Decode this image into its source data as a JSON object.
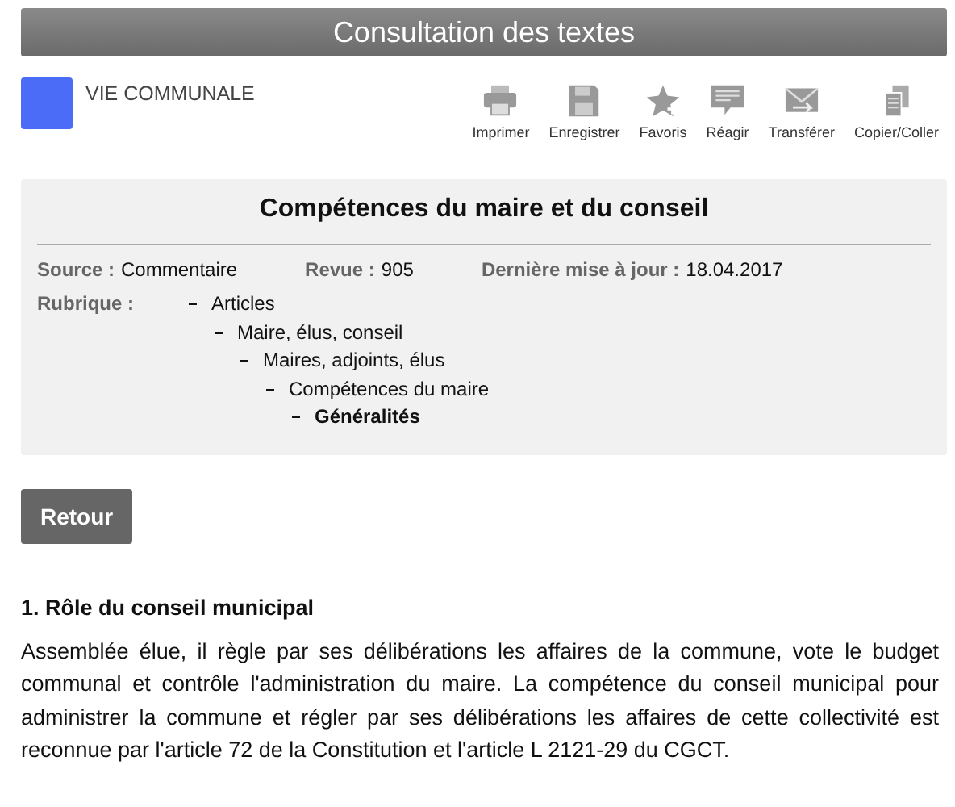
{
  "header": {
    "title": "Consultation des textes"
  },
  "category": {
    "color": "#4a6cf7",
    "label": "VIE COMMUNALE"
  },
  "toolbar": [
    {
      "kind": "print",
      "label": "Imprimer"
    },
    {
      "kind": "save",
      "label": "Enregistrer"
    },
    {
      "kind": "favorite",
      "label": "Favoris"
    },
    {
      "kind": "comment",
      "label": "Réagir"
    },
    {
      "kind": "mail",
      "label": "Transférer"
    },
    {
      "kind": "copy",
      "label": "Copier/Coller"
    }
  ],
  "document": {
    "title": "Compétences du maire et du conseil",
    "meta": [
      {
        "label": "Source :",
        "value": "Commentaire"
      },
      {
        "label": "Revue :",
        "value": "905"
      },
      {
        "label": "Dernière mise à jour :",
        "value": "18.04.2017"
      }
    ],
    "rubrique_label": "Rubrique :",
    "rubrique": [
      {
        "label": "Articles",
        "current": false,
        "children": [
          {
            "label": "Maire, élus, conseil",
            "current": false,
            "children": [
              {
                "label": "Maires, adjoints, élus",
                "current": false,
                "children": [
                  {
                    "label": "Compétences du maire",
                    "current": false,
                    "children": [
                      {
                        "label": "Généralités",
                        "current": true
                      }
                    ]
                  }
                ]
              }
            ]
          }
        ]
      }
    ]
  },
  "back_button": "Retour",
  "section": {
    "heading": "1. Rôle du conseil municipal",
    "paragraph": "Assemblée élue, il règle par ses délibérations les affaires de la commune, vote le budget communal et contrôle l'administration du maire. La compétence du conseil municipal pour administrer la commune et régler par ses délibérations les affaires de cette collectivité est reconnue par l'article 72 de la Constitution et l'article L 2121-29 du CGCT."
  }
}
